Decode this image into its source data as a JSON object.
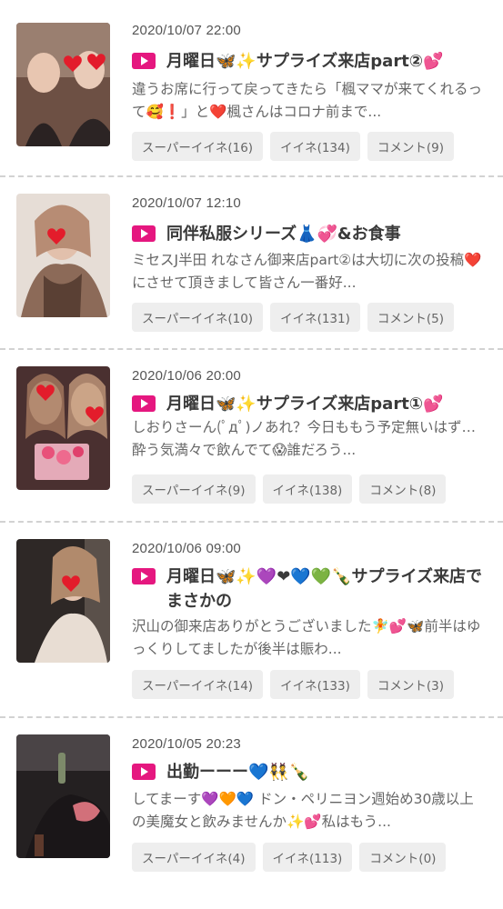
{
  "posts": [
    {
      "date": "2020/10/07 22:00",
      "title": "月曜日🦋✨サプライズ来店part②💕",
      "excerpt": "違うお席に行って戻ってきたら「楓ママが来てくれるって🥰❗」と❤️楓さんはコロナ前まで...",
      "super_like": "スーパーイイネ(16)",
      "like": "イイネ(134)",
      "comment": "コメント(9)",
      "thumb_color": "#7a5a4a"
    },
    {
      "date": "2020/10/07 12:10",
      "title": "同伴私服シリーズ👗💞&お食事",
      "excerpt": "ミセスJ半田 れなさん御来店part②は大切に次の投稿❤️にさせて頂きまして皆さん一番好...",
      "super_like": "スーパーイイネ(10)",
      "like": "イイネ(131)",
      "comment": "コメント(5)",
      "thumb_color": "#b89a84"
    },
    {
      "date": "2020/10/06 20:00",
      "title": "月曜日🦋✨サプライズ来店part①💕",
      "excerpt": "しおりさーん(ﾟдﾟ)ノあれ？今日ももう予定無いはず…酔う気満々で飲んでて😱誰だろう...",
      "super_like": "スーパーイイネ(9)",
      "like": "イイネ(138)",
      "comment": "コメント(8)",
      "thumb_color": "#5e3a3a"
    },
    {
      "date": "2020/10/06 09:00",
      "title": "月曜日🦋✨💜❤💙💚🍾サプライズ来店でまさかの",
      "excerpt": "沢山の御来店ありがとうございました🧚💕🦋前半はゆっくりしてましたが後半は賑わ...",
      "super_like": "スーパーイイネ(14)",
      "like": "イイネ(133)",
      "comment": "コメント(3)",
      "thumb_color": "#3c3430"
    },
    {
      "date": "2020/10/05 20:23",
      "title": "出勤ーーー💙👯🍾",
      "excerpt": "してまーす💜🧡💙 ドン・ペリニヨン週始め30歳以上の美魔女と飲みませんか✨💕私はもう...",
      "super_like": "スーパーイイネ(4)",
      "like": "イイネ(113)",
      "comment": "コメント(0)",
      "thumb_color": "#2e2a2a"
    }
  ]
}
